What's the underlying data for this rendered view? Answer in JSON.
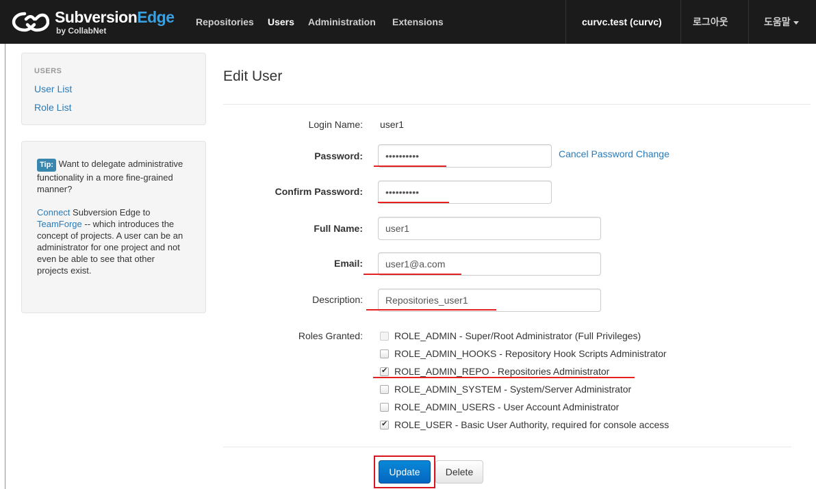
{
  "navbar": {
    "brand_name": "Subversion",
    "brand_name_accent": "Edge",
    "brand_sub": "by CollabNet",
    "items": [
      "Repositories",
      "Users",
      "Administration",
      "Extensions"
    ],
    "active_item": "Users",
    "user": "curvc.test (curvc)",
    "logout": "로그아웃",
    "help": "도움말"
  },
  "sidebar": {
    "header": "USERS",
    "links": [
      "User List",
      "Role List"
    ],
    "tip": {
      "label": "Tip:",
      "text1": "Want to delegate administrative functionality in a more fine-grained manner?",
      "link1": "Connect",
      "text2": "Subversion Edge to",
      "link2": "TeamForge",
      "text3": "-- which introduces the concept of projects. A user can be an administrator for one project and not even be able to see that other projects exist."
    }
  },
  "form": {
    "title": "Edit User",
    "login_label": "Login Name:",
    "login_value": "user1",
    "password_label": "Password:",
    "password_value": "••••••••••",
    "cancel_password": "Cancel Password Change",
    "confirm_label": "Confirm Password:",
    "confirm_value": "••••••••••",
    "fullname_label": "Full Name:",
    "fullname_value": "user1",
    "email_label": "Email:",
    "email_value": "user1@a.com",
    "description_label": "Description:",
    "description_value": "Repositories_user1",
    "roles_label": "Roles Granted:",
    "roles": [
      {
        "label": "ROLE_ADMIN - Super/Root Administrator (Full Privileges)",
        "checked": false,
        "disabled": true
      },
      {
        "label": "ROLE_ADMIN_HOOKS - Repository Hook Scripts Administrator",
        "checked": false,
        "disabled": false
      },
      {
        "label": "ROLE_ADMIN_REPO - Repositories Administrator",
        "checked": true,
        "disabled": false
      },
      {
        "label": "ROLE_ADMIN_SYSTEM - System/Server Administrator",
        "checked": false,
        "disabled": false
      },
      {
        "label": "ROLE_ADMIN_USERS - User Account Administrator",
        "checked": false,
        "disabled": false
      },
      {
        "label": "ROLE_USER - Basic User Authority, required for console access",
        "checked": true,
        "disabled": false
      }
    ],
    "update_button": "Update",
    "delete_button": "Delete"
  },
  "colors": {
    "navbar_bg": "#1b1b1b",
    "link": "#2a7ab8",
    "primary": "#0466c0",
    "annotation_red": "#e52020"
  }
}
